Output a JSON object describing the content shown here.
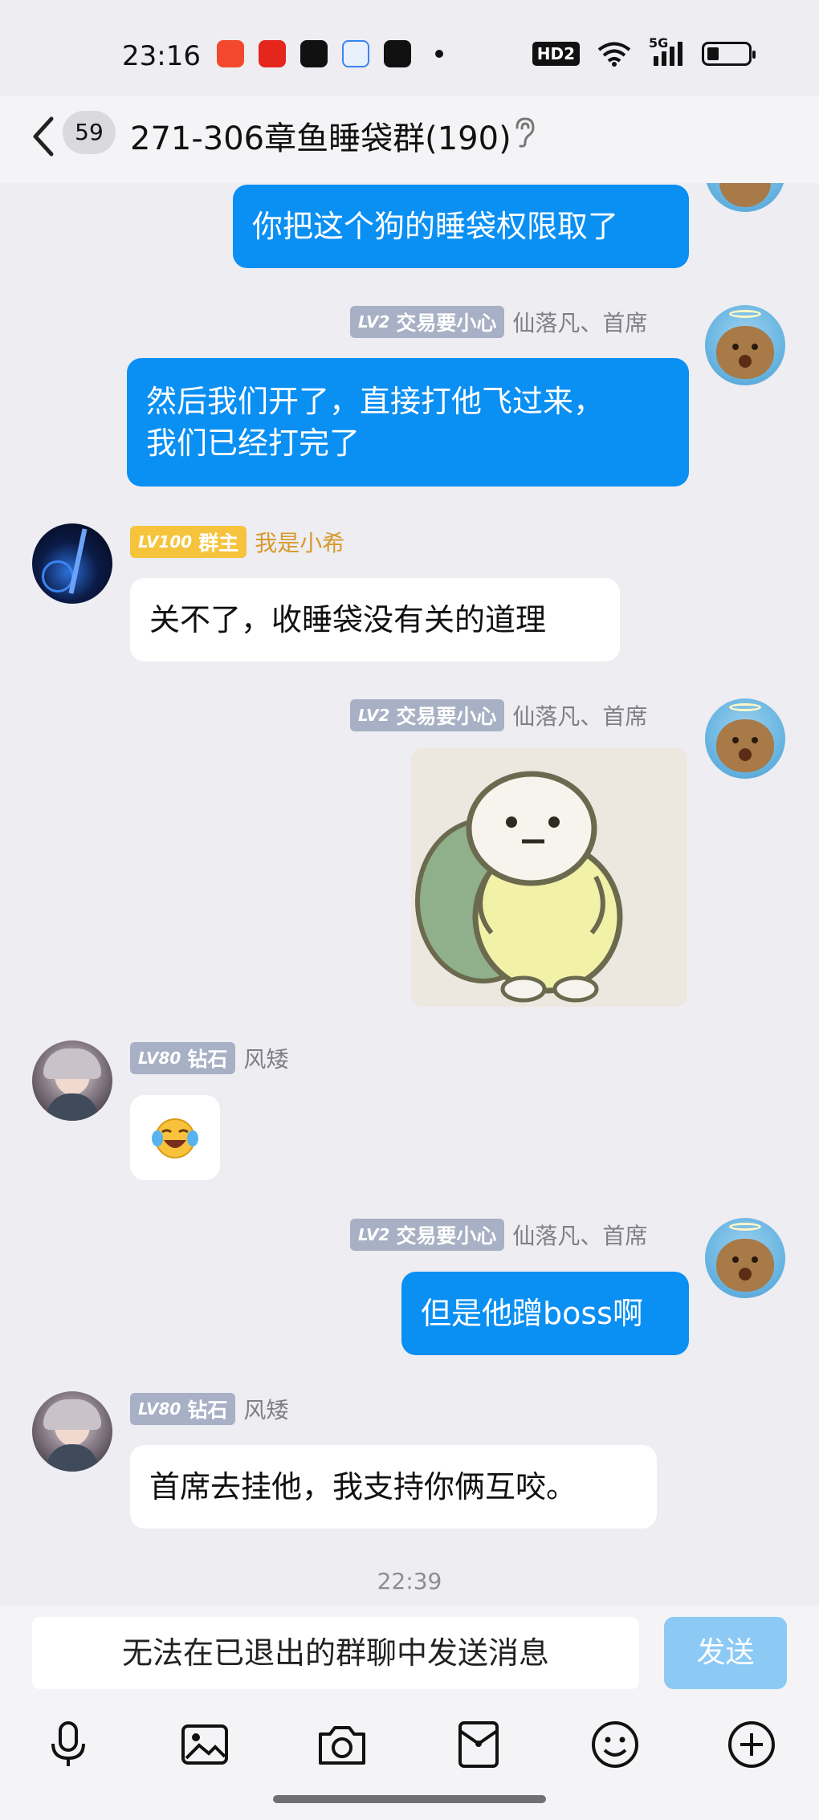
{
  "status_bar": {
    "time": "23:16",
    "network": "5G",
    "hd_label": "HD2"
  },
  "header": {
    "unread_count": "59",
    "title": "271-306章鱼睡袋群(190)"
  },
  "messages": [
    {
      "side": "right",
      "text": "你把这个狗的睡袋权限取了"
    },
    {
      "side": "right",
      "badge": {
        "level": "LV2",
        "text": "交易要小心"
      },
      "sender": "仙落凡、首席",
      "text_lines": [
        "然后我们开了，直接打他飞过来，",
        "我们已经打完了"
      ]
    },
    {
      "side": "left",
      "badge": {
        "level": "LV100",
        "text": "群主"
      },
      "sender": "我是小希",
      "text": "关不了，收睡袋没有关的道理"
    },
    {
      "side": "right",
      "badge": {
        "level": "LV2",
        "text": "交易要小心"
      },
      "sender": "仙落凡、首席",
      "type": "sticker"
    },
    {
      "side": "left",
      "badge": {
        "level": "LV80",
        "text": "钻石"
      },
      "sender": "风矮",
      "text": "😂"
    },
    {
      "side": "right",
      "badge": {
        "level": "LV2",
        "text": "交易要小心"
      },
      "sender": "仙落凡、首席",
      "text": "但是他蹭boss啊"
    },
    {
      "side": "left",
      "badge": {
        "level": "LV80",
        "text": "钻石"
      },
      "sender": "风矮",
      "text": "首席去挂他，我支持你俩互咬。"
    }
  ],
  "timestamp": "22:39",
  "input": {
    "placeholder": "无法在已退出的群聊中发送消息",
    "send_label": "发送"
  },
  "toolbar": [
    "mic-icon",
    "image-icon",
    "camera-icon",
    "red-packet-icon",
    "emoji-icon",
    "plus-icon"
  ],
  "colors": {
    "bubble_blue": "#0a8ff3",
    "background": "#ededf2",
    "badge_gray": "#a7b0c4",
    "badge_gold": "#f6c33d",
    "owner_name": "#d79a2b"
  }
}
